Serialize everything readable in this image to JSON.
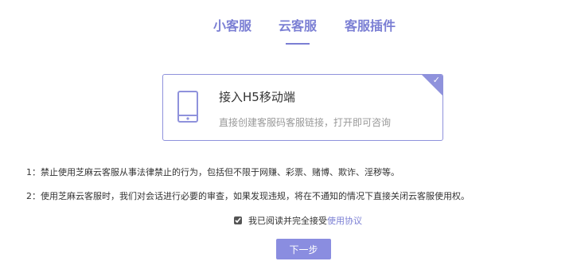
{
  "tabs": [
    {
      "label": "小客服"
    },
    {
      "label": "云客服",
      "active": true
    },
    {
      "label": "客服插件"
    }
  ],
  "card": {
    "title": "接入H5移动端",
    "description": "直接创建客服码客服链接，打开即可咨询",
    "selected": true,
    "icon": "mobile-phone-icon"
  },
  "rules": [
    "1：禁止使用芝麻云客服从事法律禁止的行为，包括但不限于网赚、彩票、赌博、欺诈、淫秽等。",
    "2：使用芝麻云客服时，我们对会话进行必要的审查，如果发现违规，将在不通知的情况下直接关闭云客服使用权。"
  ],
  "agreement": {
    "checked": true,
    "text": "我已阅读并完全接受",
    "link_text": "使用协议"
  },
  "next_button": {
    "label": "下一步"
  },
  "colors": {
    "accent": "#7b7fd4",
    "card_border": "#8f92dc",
    "button_bg": "#8a8de0",
    "muted_text": "#999999"
  }
}
